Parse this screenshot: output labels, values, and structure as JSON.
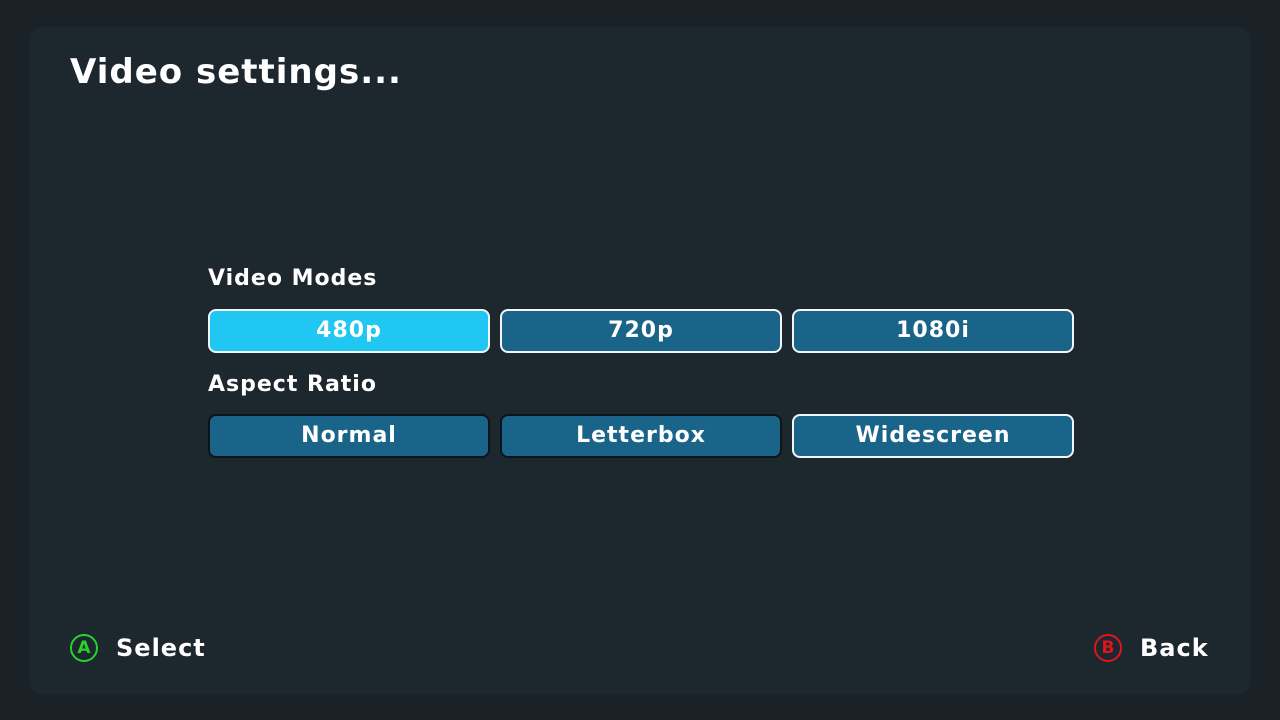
{
  "screen": {
    "title": "Video settings..."
  },
  "video_modes": {
    "label": "Video Modes",
    "options": [
      "480p",
      "720p",
      "1080i"
    ],
    "selected": "480p"
  },
  "aspect_ratio": {
    "label": "Aspect Ratio",
    "options": [
      "Normal",
      "Letterbox",
      "Widescreen"
    ],
    "selected": "Widescreen"
  },
  "footer": {
    "select": {
      "glyph": "A",
      "label": "Select",
      "icon": "a-button-icon",
      "color": "#2ad12e"
    },
    "back": {
      "glyph": "B",
      "label": "Back",
      "icon": "b-button-icon",
      "color": "#e0141e"
    }
  },
  "colors": {
    "background": "#1c272e",
    "option": "#1a6489",
    "option_highlight": "#1fc7f2",
    "text": "#ffffff"
  }
}
